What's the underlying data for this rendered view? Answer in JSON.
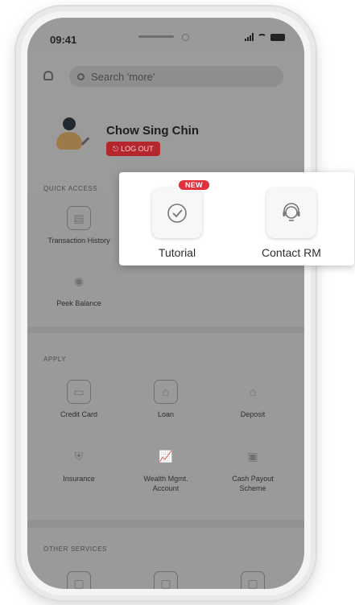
{
  "status_bar": {
    "time": "09:41"
  },
  "search": {
    "placeholder": "Search 'more'"
  },
  "profile": {
    "name": "Chow Sing Chin",
    "logout_label": "LOG OUT"
  },
  "quick_access": {
    "label": "QUICK ACCESS",
    "items": [
      {
        "label": "Transaction History",
        "icon": "transaction-history-icon"
      },
      {
        "label": "Peek Balance",
        "icon": "peek-balance-icon"
      }
    ]
  },
  "apply": {
    "label": "APPLY",
    "items": [
      {
        "label": "Credit Card",
        "icon": "credit-card-icon"
      },
      {
        "label": "Loan",
        "icon": "loan-icon"
      },
      {
        "label": "Deposit",
        "icon": "deposit-icon"
      },
      {
        "label": "Insurance",
        "icon": "insurance-icon"
      },
      {
        "label": "Wealth Mgmt. Account",
        "icon": "wealth-chart-icon"
      },
      {
        "label": "Cash Payout Scheme",
        "icon": "cash-payout-icon"
      }
    ]
  },
  "other_services": {
    "label": "OTHER SERVICES"
  },
  "popup": {
    "badge": "NEW",
    "items": [
      {
        "label": "Tutorial",
        "icon": "tutorial-check-icon"
      },
      {
        "label": "Contact RM",
        "icon": "headset-icon"
      }
    ]
  },
  "colors": {
    "accent": "#e2303a",
    "dim_overlay": "#9a9a9a"
  }
}
